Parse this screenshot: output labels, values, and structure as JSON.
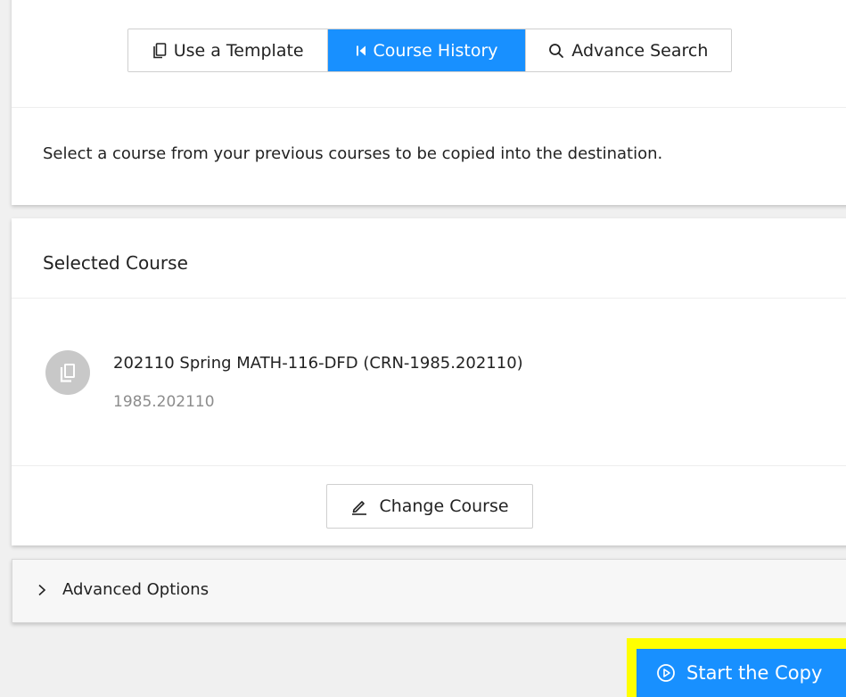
{
  "tabs": [
    {
      "label": "Use a Template",
      "icon": "copy-icon",
      "active": false
    },
    {
      "label": "Course History",
      "icon": "skip-back-icon",
      "active": true
    },
    {
      "label": "Advance Search",
      "icon": "search-icon",
      "active": false
    }
  ],
  "instruction": "Select a course from your previous courses to be copied into the destination.",
  "selected": {
    "title": "Selected Course",
    "course_name": "202110 Spring MATH-116-DFD (CRN-1985.202110)",
    "course_code": "1985.202110",
    "avatar_icon": "copy-icon",
    "change_label": "Change Course",
    "change_icon": "edit-icon"
  },
  "advanced": {
    "label": "Advanced Options",
    "icon": "chevron-right-icon"
  },
  "start": {
    "label": "Start the Copy",
    "icon": "play-circle-icon"
  },
  "colors": {
    "accent": "#1890ff",
    "highlight": "#ffff00",
    "avatar": "#c8c8c8",
    "muted_text": "#8c8c8c"
  }
}
